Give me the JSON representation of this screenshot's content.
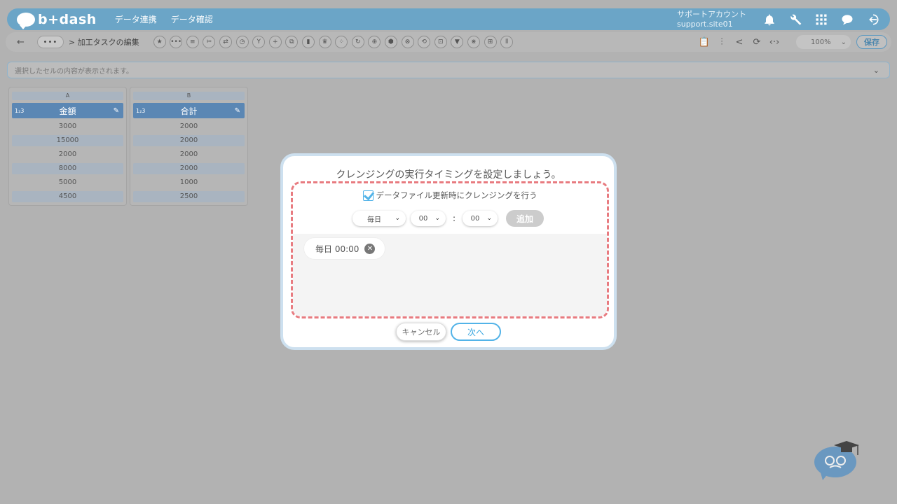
{
  "header": {
    "logo": "b+dash",
    "nav": [
      "データ連携",
      "データ確認"
    ],
    "account_label": "サポートアカウント",
    "account_site": "support.site01"
  },
  "toolbar": {
    "back": "←",
    "more": "•••",
    "breadcrumb": "> 加工タスクの編集",
    "tool_glyphs": [
      "★",
      "•••",
      "≡",
      "✂",
      "⇄",
      "◷",
      "Y",
      "+",
      "⧉",
      "▮",
      "♛",
      "⁘",
      "↻",
      "⊕",
      "⬢",
      "⊗",
      "⟲",
      "⊡",
      "▼",
      "⋇",
      "⊞",
      "⫴"
    ],
    "right_glyphs": [
      "📋",
      "⫶",
      "<",
      "⟳",
      "‹·›"
    ],
    "zoom": "100%",
    "save_label": "保存"
  },
  "cellbar": {
    "placeholder": "選択したセルの内容が表示されます。"
  },
  "columns": [
    {
      "letter": "A",
      "type": "1₂3",
      "name": "金額",
      "values": [
        "3000",
        "15000",
        "2000",
        "8000",
        "5000",
        "4500"
      ]
    },
    {
      "letter": "B",
      "type": "1₂3",
      "name": "合計",
      "values": [
        "2000",
        "2000",
        "2000",
        "2000",
        "1000",
        "2500"
      ]
    }
  ],
  "modal": {
    "title": "クレンジングの実行タイミングを設定しましょう。",
    "checkbox_label": "データファイル更新時にクレンジングを行う",
    "checkbox_checked": true,
    "frequency": "毎日",
    "hour": "00",
    "minute": "00",
    "colon": ":",
    "add_label": "追加",
    "schedules": [
      "毎日 00:00"
    ],
    "cancel_label": "キャンセル",
    "next_label": "次へ"
  },
  "colors": {
    "accent": "#52b3e8",
    "header_bg": "#6ba5c7",
    "dashed_border": "#e87b80",
    "overlay": "#b2b2b2"
  }
}
